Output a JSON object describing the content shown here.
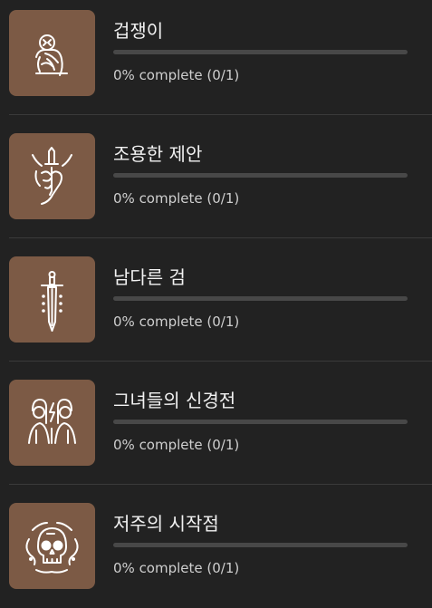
{
  "achievements": [
    {
      "title": "겁쟁이",
      "status": "0% complete (0/1)",
      "progress": 0,
      "icon": "cowering-figure-icon"
    },
    {
      "title": "조용한 제안",
      "status": "0% complete (0/1)",
      "progress": 0,
      "icon": "hand-with-dagger-icon"
    },
    {
      "title": "남다른 검",
      "status": "0% complete (0/1)",
      "progress": 0,
      "icon": "sword-icon"
    },
    {
      "title": "그녀들의 신경전",
      "status": "0% complete (0/1)",
      "progress": 0,
      "icon": "two-women-lightning-icon"
    },
    {
      "title": "저주의 시작점",
      "status": "0% complete (0/1)",
      "progress": 0,
      "icon": "cursed-skull-icon"
    }
  ],
  "colors": {
    "background": "#222222",
    "icon_tile": "#7c5a45",
    "progress_track": "#484848",
    "divider": "#3a3a3a"
  }
}
